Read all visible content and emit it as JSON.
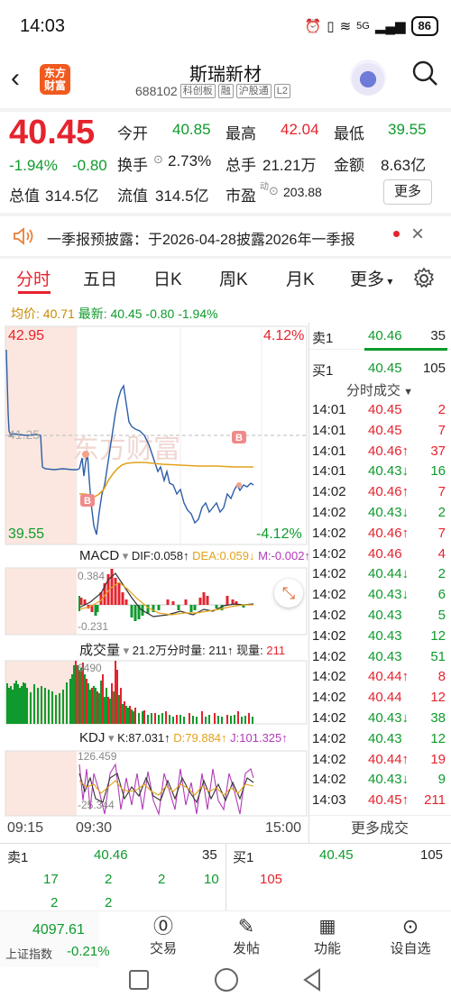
{
  "status_bar": {
    "time": "14:03",
    "network": "5G",
    "battery": "86"
  },
  "header": {
    "logo_text_1": "东方",
    "logo_text_2": "财富",
    "stock_name": "斯瑞新材",
    "stock_code": "688102",
    "tags": [
      "科创板",
      "融",
      "沪股通",
      "L2"
    ]
  },
  "quote": {
    "price": "40.45",
    "change_pct": "-1.94%",
    "change": "-0.80",
    "open_label": "今开",
    "open": "40.85",
    "high_label": "最高",
    "high": "42.04",
    "low_label": "最低",
    "low": "39.55",
    "turnover_label": "换手",
    "turnover": "2.73%",
    "volume_label": "总手",
    "volume": "21.21万",
    "amount_label": "金额",
    "amount": "8.63亿",
    "total_cap_label": "总值",
    "total_cap": "314.5亿",
    "float_cap_label": "流值",
    "float_cap": "314.5亿",
    "pe_label": "市盈",
    "pe_sup": "动",
    "pe": "203.88",
    "more_label": "更多"
  },
  "notice": {
    "text": "一季报预披露：于2026-04-28披露2026年一季报"
  },
  "tabs": [
    "分时",
    "五日",
    "日K",
    "周K",
    "月K",
    "更多"
  ],
  "chart": {
    "avg_label": "均价:",
    "avg_value": "40.71",
    "latest_label": "最新:",
    "latest_value": "40.45 -0.80 -1.94%",
    "y_high": "42.95",
    "y_mid": "41.25",
    "y_low": "39.55",
    "pct_high": "4.12%",
    "pct_low": "-4.12%",
    "macd": {
      "name": "MACD",
      "dif": "DIF:0.058↑",
      "dea": "DEA:0.059↓",
      "m": "M:-0.002↑",
      "top": "0.384",
      "bottom": "-0.231"
    },
    "vol": {
      "name": "成交量",
      "info": "21.2万分时量:",
      "fen": "211↑",
      "now_label": "现量:",
      "now": "211",
      "top": "6490"
    },
    "kdj": {
      "name": "KDJ",
      "k": "K:87.031↑",
      "d": "D:79.884↑",
      "j": "J:101.325↑",
      "top": "126.459",
      "bottom": "-25.344"
    },
    "time_start": "09:15",
    "time_open": "09:30",
    "time_end": "15:00",
    "watermark": "东方财富"
  },
  "book": {
    "sell1_label": "卖1",
    "sell1_price": "40.46",
    "sell1_vol": "35",
    "buy1_label": "买1",
    "buy1_price": "40.45",
    "buy1_vol": "105",
    "ticks_title": "分时成交"
  },
  "ticks": [
    {
      "t": "14:01",
      "p": "40.45",
      "v": "2",
      "c": "red"
    },
    {
      "t": "14:01",
      "p": "40.45",
      "v": "7",
      "c": "red"
    },
    {
      "t": "14:01",
      "p": "40.46↑",
      "v": "37",
      "c": "red"
    },
    {
      "t": "14:01",
      "p": "40.43↓",
      "v": "16",
      "c": "green"
    },
    {
      "t": "14:02",
      "p": "40.46↑",
      "v": "7",
      "c": "red"
    },
    {
      "t": "14:02",
      "p": "40.43↓",
      "v": "2",
      "c": "green"
    },
    {
      "t": "14:02",
      "p": "40.46↑",
      "v": "7",
      "c": "red"
    },
    {
      "t": "14:02",
      "p": "40.46",
      "v": "4",
      "c": "red"
    },
    {
      "t": "14:02",
      "p": "40.44↓",
      "v": "2",
      "c": "green"
    },
    {
      "t": "14:02",
      "p": "40.43↓",
      "v": "6",
      "c": "green"
    },
    {
      "t": "14:02",
      "p": "40.43",
      "v": "5",
      "c": "green"
    },
    {
      "t": "14:02",
      "p": "40.43",
      "v": "12",
      "c": "green"
    },
    {
      "t": "14:02",
      "p": "40.43",
      "v": "51",
      "c": "green"
    },
    {
      "t": "14:02",
      "p": "40.44↑",
      "v": "8",
      "c": "red"
    },
    {
      "t": "14:02",
      "p": "40.44",
      "v": "12",
      "c": "red"
    },
    {
      "t": "14:02",
      "p": "40.43↓",
      "v": "38",
      "c": "green"
    },
    {
      "t": "14:02",
      "p": "40.43",
      "v": "12",
      "c": "green"
    },
    {
      "t": "14:02",
      "p": "40.44↑",
      "v": "19",
      "c": "red"
    },
    {
      "t": "14:02",
      "p": "40.43↓",
      "v": "9",
      "c": "green"
    },
    {
      "t": "14:03",
      "p": "40.45↑",
      "v": "211",
      "c": "red"
    }
  ],
  "more_trades": "更多成交",
  "bottom_book": {
    "sell1_label": "卖1",
    "sell1_price": "40.46",
    "sell1_vol": "35",
    "buy1_label": "买1",
    "buy1_price": "40.45",
    "buy1_vol": "105",
    "sell_row1": [
      "17",
      "2",
      "2",
      "10"
    ],
    "sell_row2": [
      "2",
      "2"
    ],
    "buy_row1": [
      "105"
    ]
  },
  "nav": {
    "index_value": "4097.61",
    "index_name": "上证指数",
    "index_change": "-0.21%",
    "items": [
      "交易",
      "发帖",
      "功能",
      "设自选"
    ]
  }
}
